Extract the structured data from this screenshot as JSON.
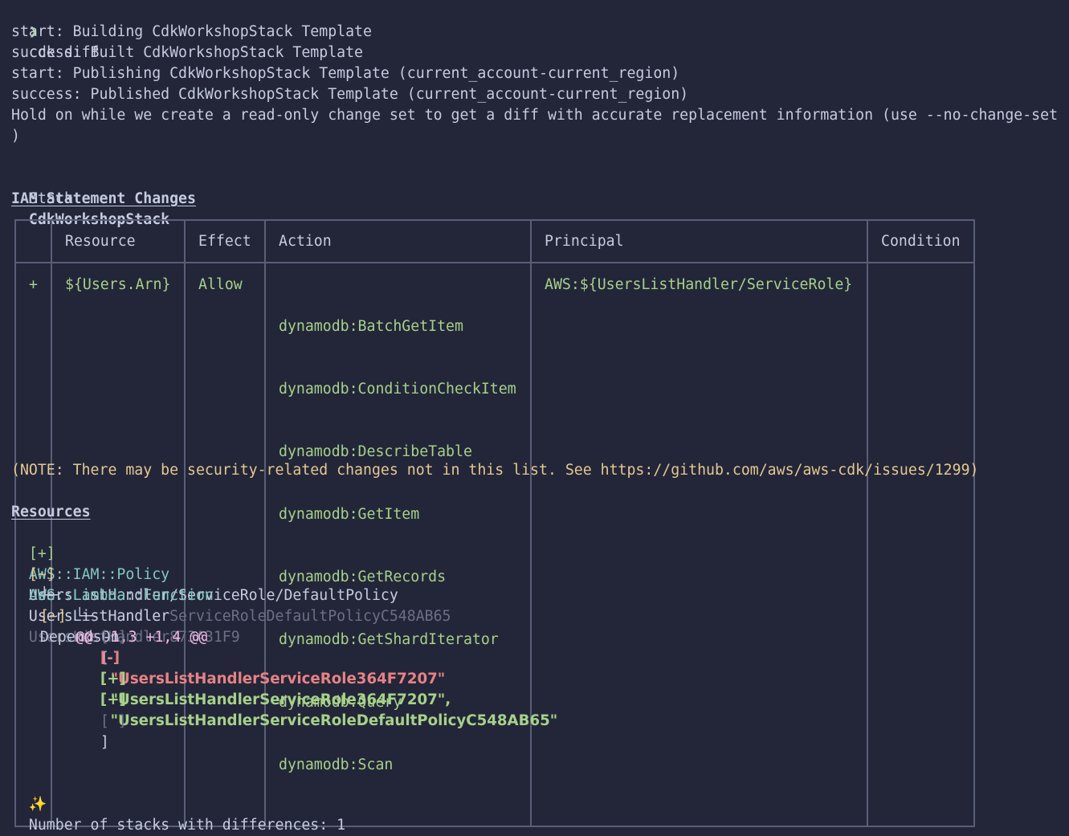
{
  "prompt": {
    "symbol": "❯",
    "command": "cdk diff"
  },
  "log_lines": [
    "start: Building CdkWorkshopStack Template",
    "success: Built CdkWorkshopStack Template",
    "start: Publishing CdkWorkshopStack Template (current_account-current_region)",
    "success: Published CdkWorkshopStack Template (current_account-current_region)",
    "Hold on while we create a read-only change set to get a diff with accurate replacement information (use --no-change-set",
    ")"
  ],
  "stack": {
    "prefix": "Stack",
    "name": "CdkWorkshopStack"
  },
  "iam_heading": "IAM Statement Changes",
  "iam_table": {
    "headers": [
      "",
      "Resource",
      "Effect",
      "Action",
      "Principal",
      "Condition"
    ],
    "row": {
      "marker": "+",
      "resource": "${Users.Arn}",
      "effect": "Allow",
      "actions": [
        "dynamodb:BatchGetItem",
        "dynamodb:ConditionCheckItem",
        "dynamodb:DescribeTable",
        "dynamodb:GetItem",
        "dynamodb:GetRecords",
        "dynamodb:GetShardIterator",
        "dynamodb:Query",
        "dynamodb:Scan"
      ],
      "principal": "AWS:${UsersListHandler/ServiceRole}",
      "condition": ""
    }
  },
  "note": "(NOTE: There may be security-related changes not in this list. See https://github.com/aws/aws-cdk/issues/1299)",
  "resources_heading": "Resources",
  "resources": [
    {
      "marker": "[+]",
      "type": "AWS::IAM::Policy",
      "path": "UsersListHandler/ServiceRole/DefaultPolicy",
      "logical_id": "UsersListHandlerServiceRoleDefaultPolicyC548AB65"
    },
    {
      "marker": "[~]",
      "type": "AWS::Lambda::Function",
      "path": "UsersListHandler",
      "logical_id": "UsersListHandler873A31F9"
    }
  ],
  "depends_on": {
    "branch": "└─",
    "marker": "[~]",
    "label": "DependsOn"
  },
  "hunk": {
    "branch": "└─",
    "header": "@@ -1,3 +1,4 @@"
  },
  "diff_lines": [
    {
      "marker": "[ ]",
      "text": "["
    },
    {
      "marker": "[-]",
      "text": "  \"UsersListHandlerServiceRole364F7207\""
    },
    {
      "marker": "[+]",
      "text": "  \"UsersListHandlerServiceRole364F7207\","
    },
    {
      "marker": "[+]",
      "text": "  \"UsersListHandlerServiceRoleDefaultPolicyC548AB65\""
    },
    {
      "marker": "[ ]",
      "text": "]"
    }
  ],
  "summary": {
    "icon": "sparkles-icon",
    "glyph": "✨",
    "text": "Number of stacks with differences: 1"
  }
}
